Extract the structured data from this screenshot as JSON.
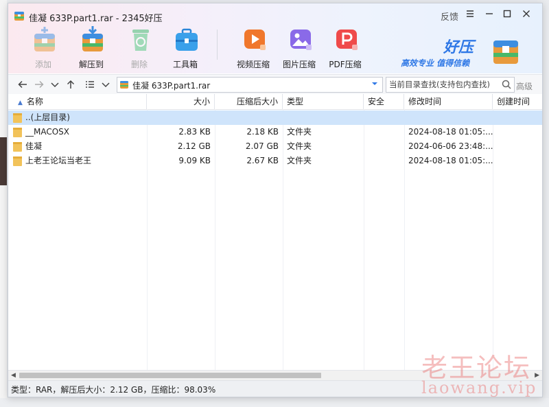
{
  "window": {
    "title": "佳凝 633P.part1.rar - 2345好压",
    "feedback_label": "反馈"
  },
  "toolbar": {
    "items": [
      {
        "label": "添加",
        "icon": "add-archive-icon",
        "disabled": true
      },
      {
        "label": "解压到",
        "icon": "extract-to-icon",
        "disabled": false
      },
      {
        "label": "删除",
        "icon": "delete-recycle-icon",
        "disabled": true
      },
      {
        "label": "工具箱",
        "icon": "toolbox-icon",
        "disabled": false
      },
      {
        "label": "视频压缩",
        "icon": "video-compress-icon",
        "disabled": false
      },
      {
        "label": "图片压缩",
        "icon": "image-compress-icon",
        "disabled": false
      },
      {
        "label": "PDF压缩",
        "icon": "pdf-compress-icon",
        "disabled": false
      }
    ]
  },
  "brand": {
    "name": "好压",
    "slogan": "高效专业 值得信赖"
  },
  "navbar": {
    "path": "佳凝 633P.part1.rar",
    "search_placeholder": "当前目录查找(支持包内查找)",
    "advanced_label": "高级"
  },
  "table": {
    "columns": [
      "名称",
      "大小",
      "压缩后大小",
      "类型",
      "安全",
      "修改时间",
      "创建时间"
    ],
    "rows": [
      {
        "name": "..(上层目录)",
        "size": "",
        "packed": "",
        "type": "",
        "security": "",
        "modified": "",
        "created": "",
        "selected": true
      },
      {
        "name": "__MACOSX",
        "size": "2.83 KB",
        "packed": "2.18 KB",
        "type": "文件夹",
        "security": "",
        "modified": "2024-08-18 01:05:...",
        "created": ""
      },
      {
        "name": "佳凝",
        "size": "2.12 GB",
        "packed": "2.07 GB",
        "type": "文件夹",
        "security": "",
        "modified": "2024-06-06 23:48:...",
        "created": ""
      },
      {
        "name": "上老王论坛当老王",
        "size": "9.09 KB",
        "packed": "2.67 KB",
        "type": "文件夹",
        "security": "",
        "modified": "2024-08-18 01:05:...",
        "created": ""
      }
    ]
  },
  "status": {
    "text": "类型：RAR，解压后大小：2.12 GB，压缩比：98.03%"
  },
  "watermark": {
    "line1": "老王论坛",
    "line2": "laowang.vip"
  },
  "colors": {
    "accent": "#2f78e6",
    "selected_row": "#cfe4fb",
    "folder": "#f2c35a",
    "watermark": "#e86e6e"
  }
}
